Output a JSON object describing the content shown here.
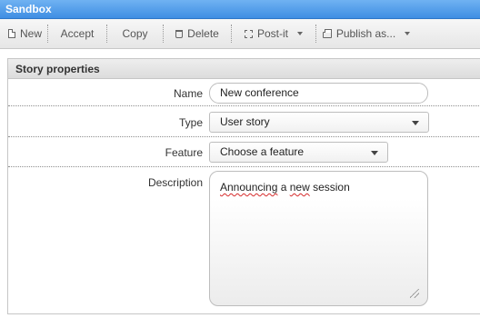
{
  "window": {
    "title": "Sandbox"
  },
  "toolbar": {
    "buttons": [
      {
        "label": "New",
        "icon": "new-document-icon"
      },
      {
        "label": "Accept"
      },
      {
        "label": "Copy"
      },
      {
        "label": "Delete",
        "icon": "trash-icon"
      },
      {
        "label": "Post-it",
        "icon": "postit-icon",
        "dropdown": true
      },
      {
        "label": "Publish as...",
        "icon": "print-icon",
        "dropdown": true
      }
    ]
  },
  "panel": {
    "title": "Story properties",
    "fields": {
      "name": {
        "label": "Name",
        "value": "New conference"
      },
      "type": {
        "label": "Type",
        "value": "User story"
      },
      "feature": {
        "label": "Feature",
        "value": "Choose a feature"
      },
      "description": {
        "label": "Description",
        "value_part1": "Announcing",
        "value_part2": " a ",
        "value_part3": "new",
        "value_part4": " session"
      }
    }
  },
  "colors": {
    "titlebar": "#3f8ee3",
    "spellcheck_underline": "#d62b2b"
  }
}
